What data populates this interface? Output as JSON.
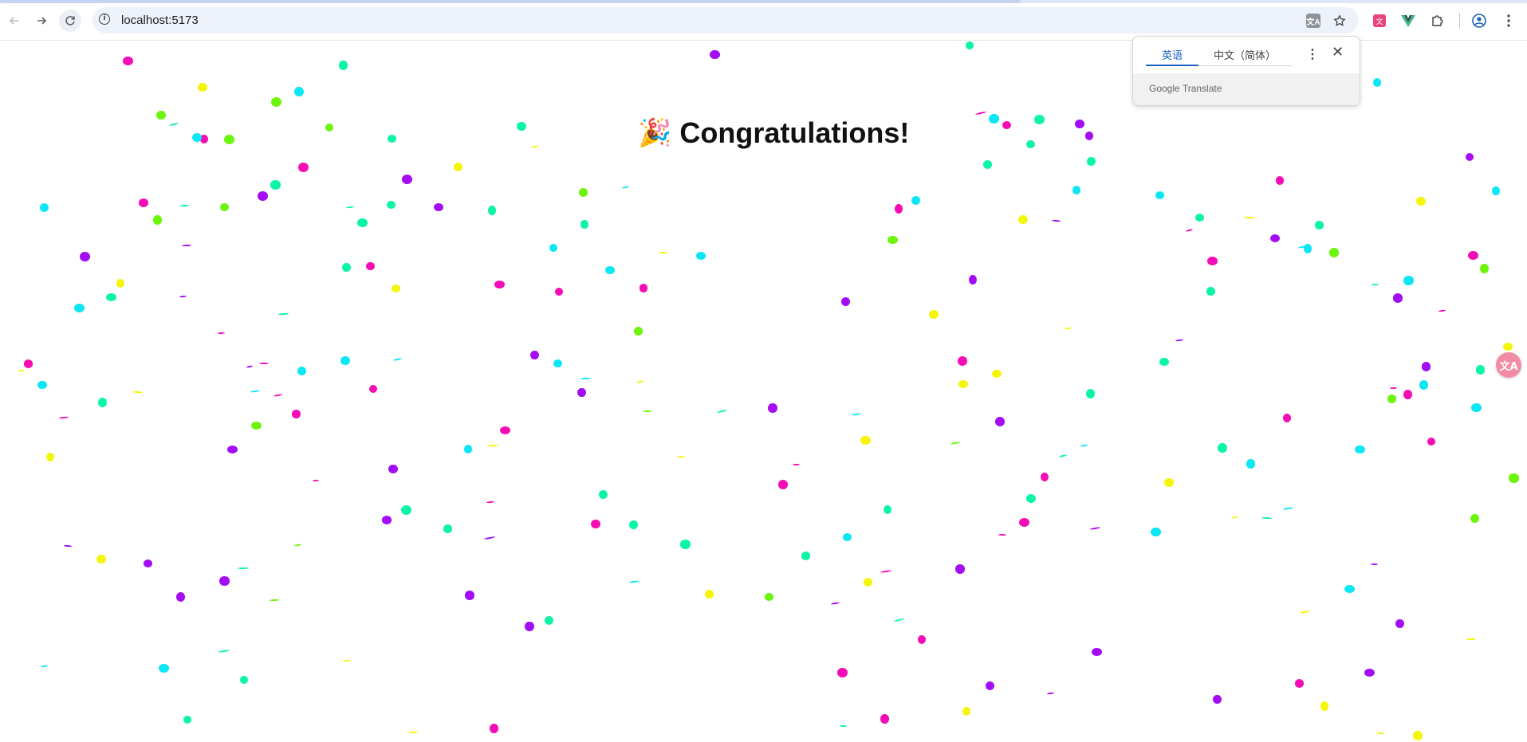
{
  "browser": {
    "url": "localhost:5173",
    "icons": {
      "back": "arrow-left-icon",
      "forward": "arrow-right-icon",
      "reload": "reload-icon",
      "site_info": "info-icon",
      "translate": "translate-icon",
      "bookmark": "star-icon",
      "extension_translate": "translate-extension-icon",
      "extension_vue": "vue-devtools-icon",
      "extensions": "puzzle-icon",
      "profile": "profile-icon",
      "menu": "kebab-menu-icon"
    }
  },
  "translate_popup": {
    "tabs": [
      "英语",
      "中文（简体）"
    ],
    "active_tab": 0,
    "footer_google": "Google",
    "footer_translate": "Translate"
  },
  "page": {
    "heading": "Congratulations!",
    "heading_icon": "party-popper-icon"
  },
  "colors": {
    "confetti": [
      "#a40cf5",
      "#f50cb5",
      "#0ce6f5",
      "#f5f50c",
      "#6cf50c",
      "#0cf5a6"
    ]
  }
}
